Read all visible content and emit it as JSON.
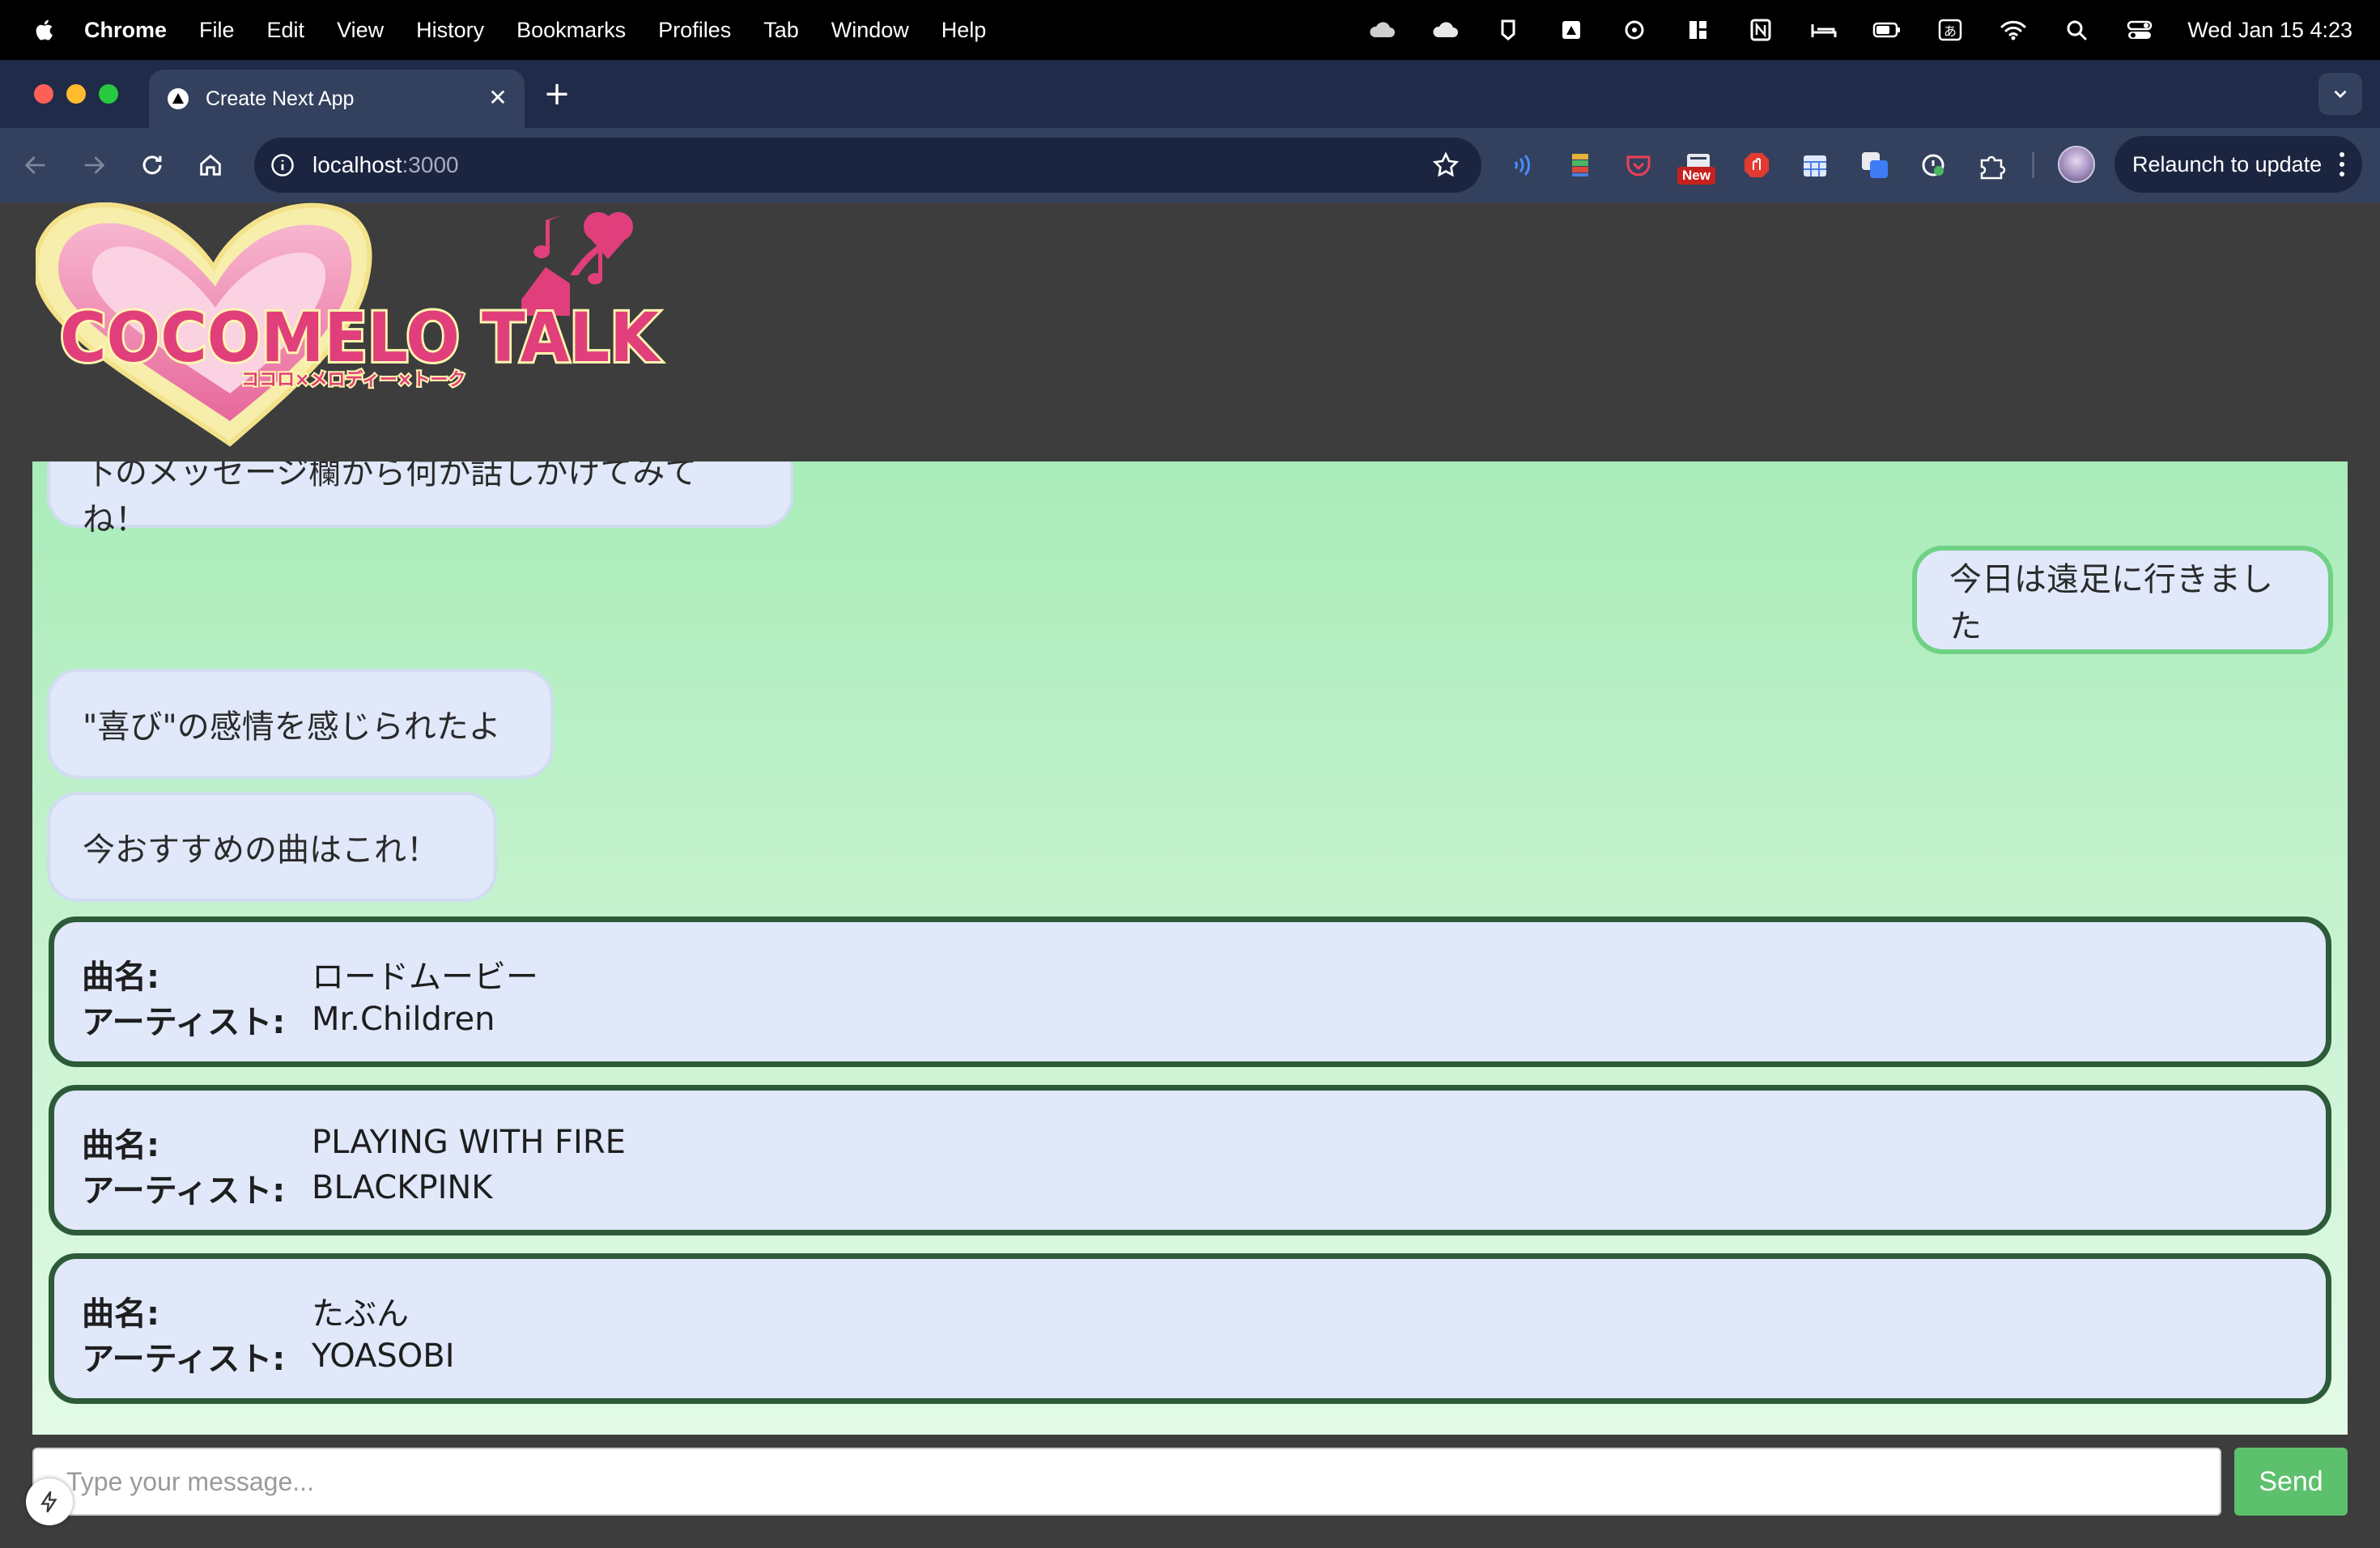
{
  "menubar": {
    "app": "Chrome",
    "items": [
      "File",
      "Edit",
      "View",
      "History",
      "Bookmarks",
      "Profiles",
      "Tab",
      "Window",
      "Help"
    ],
    "clock": "Wed Jan 15  4:23"
  },
  "browser": {
    "tab_title": "Create Next App",
    "url_host": "localhost",
    "url_port": ":3000",
    "relaunch_label": "Relaunch to update",
    "ext_new_badge": "New"
  },
  "chat": {
    "messages": [
      {
        "from": "bot",
        "text": "下のメッセージ欄から何か話しかけてみてね！"
      },
      {
        "from": "user",
        "text": "今日は遠足に行きました"
      },
      {
        "from": "bot",
        "text": "\"喜び\"の感情を感じられたよ"
      },
      {
        "from": "bot",
        "text": "今おすすめの曲はこれ！"
      }
    ],
    "song_title_label": "曲名:",
    "song_artist_label": "アーティスト:",
    "songs": [
      {
        "title": "ロードムービー",
        "artist": "Mr.Children"
      },
      {
        "title": "PLAYING WITH FIRE",
        "artist": "BLACKPINK"
      },
      {
        "title": "たぶん",
        "artist": "YOASOBI"
      }
    ]
  },
  "composer": {
    "placeholder": "Type your message...",
    "send_label": "Send"
  },
  "colors": {
    "chat_bg_top": "#a9ecb9",
    "bubble_bg": "#e0e8fa",
    "user_border": "#6fd184",
    "song_border": "#2d5a38",
    "send_bg": "#5dc06d",
    "logo_pink": "#e13f7b"
  }
}
